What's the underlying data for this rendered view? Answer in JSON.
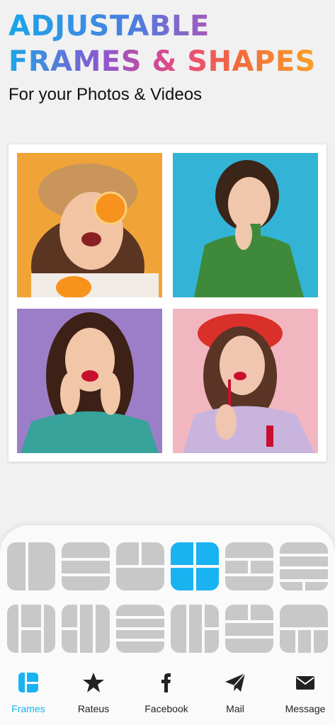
{
  "header": {
    "line1": "ADJUSTABLE",
    "line2": "FRAMES & SHAPES",
    "subtitle": "For your Photos & Videos"
  },
  "photos": [
    {
      "name": "photo-woman-orange",
      "bg": "#f0a438"
    },
    {
      "name": "photo-woman-thinking",
      "bg": "#33b4d7"
    },
    {
      "name": "photo-woman-surprised",
      "bg": "#9c7ec8"
    },
    {
      "name": "photo-woman-lipstick",
      "bg": "#f2b6c0"
    }
  ],
  "layouts": {
    "selected_index": 3,
    "accent": "#1ab3f2",
    "tile_color": "#c8c8c8",
    "count": 12
  },
  "nav": {
    "items": [
      {
        "label": "Frames",
        "icon": "frames-icon",
        "active": true
      },
      {
        "label": "Rateus",
        "icon": "star-icon",
        "active": false
      },
      {
        "label": "Facebook",
        "icon": "facebook-icon",
        "active": false
      },
      {
        "label": "Mail",
        "icon": "paper-plane-icon",
        "active": false
      },
      {
        "label": "Message",
        "icon": "envelope-icon",
        "active": false
      }
    ]
  }
}
